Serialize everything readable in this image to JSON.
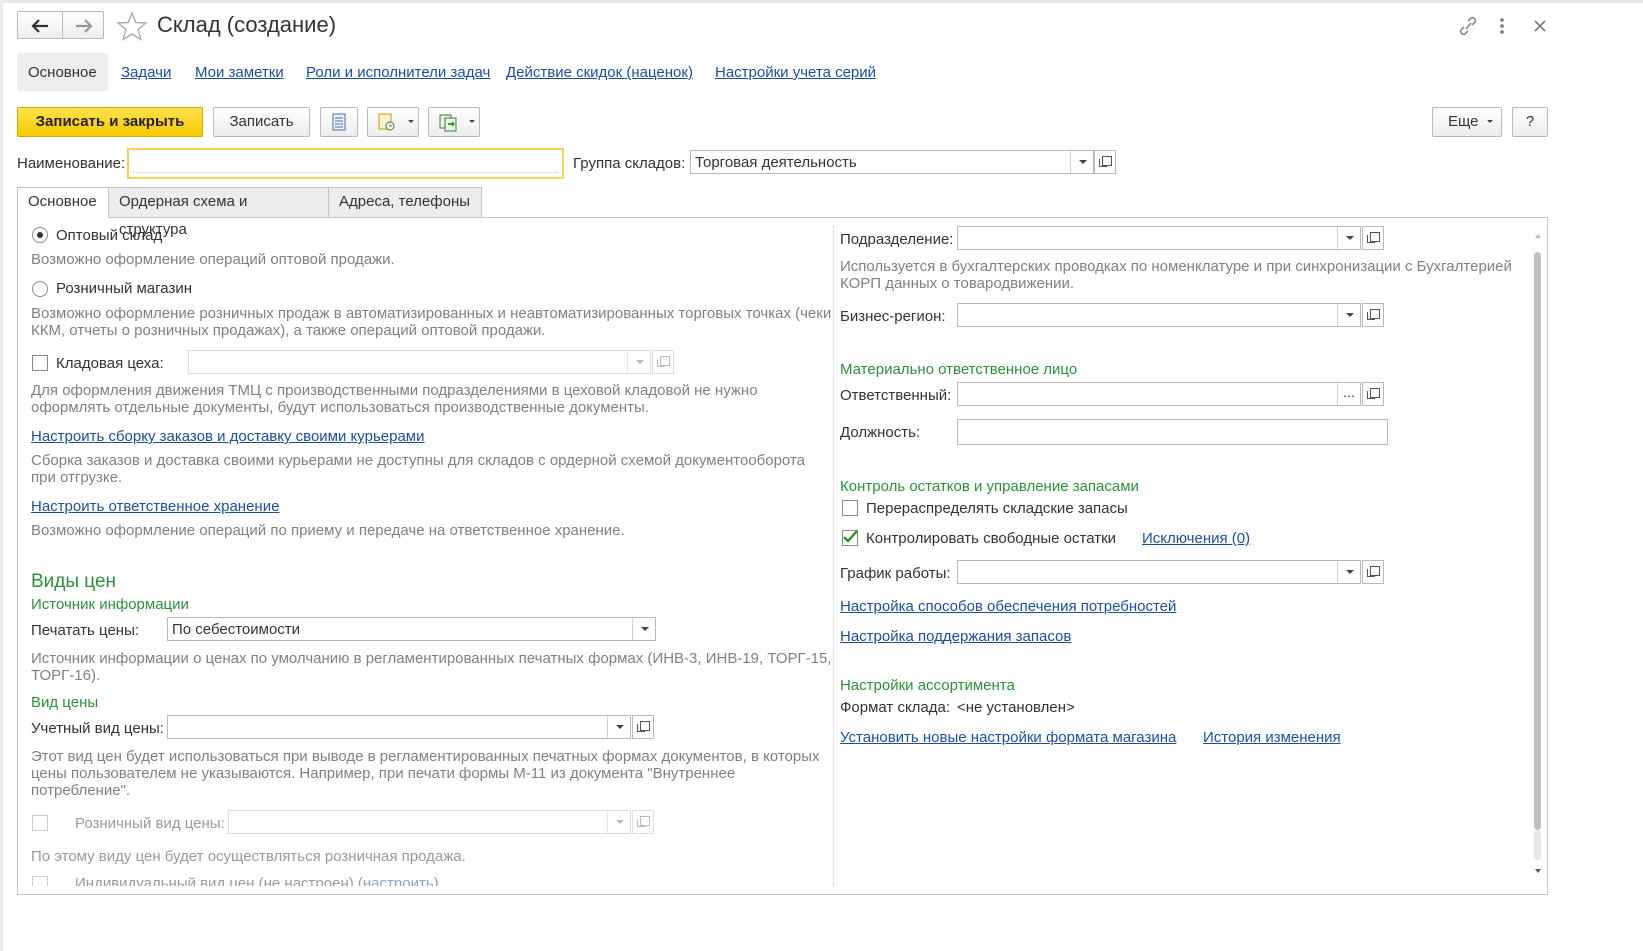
{
  "window": {
    "title": "Склад (создание)",
    "back_icon": "arrow-left-icon",
    "forward_icon": "arrow-right-icon",
    "favorite_icon": "star-icon",
    "link_icon": "link-icon",
    "more_icon": "vertical-dots-icon",
    "close_icon": "close-icon"
  },
  "nav_tabs": [
    "Основное",
    "Задачи",
    "Мои заметки",
    "Роли и исполнители задач",
    "Действие скидок (наценок)",
    "Настройки учета серий"
  ],
  "toolbar": {
    "save_close": "Записать и закрыть",
    "save": "Записать",
    "more": "Еще",
    "help": "?"
  },
  "header_fields": {
    "name_label": "Наименование:",
    "name_value": "",
    "group_label": "Группа складов:",
    "group_value": "Торговая деятельность"
  },
  "form_tabs": [
    "Основное",
    "Ордерная схема и структура",
    "Адреса, телефоны"
  ],
  "left": {
    "wholesale_label": "Оптовый склад",
    "wholesale_hint": "Возможно оформление операций оптовой продажи.",
    "retail_label": "Розничный магазин",
    "retail_hint_1": "Возможно оформление розничных продаж в автоматизированных и неавтоматизированных торговых точках (чеки",
    "retail_hint_2": "ККМ, отчеты о розничных продажах), а также операций оптовой продажи.",
    "workshop_label": "Кладовая цеха:",
    "workshop_hint_1": "Для оформления движения ТМЦ с производственными подразделениями в цеховой кладовой не нужно",
    "workshop_hint_2": "оформлять отдельные документы, будут использоваться производственные документы.",
    "courier_link": "Настроить сборку заказов и доставку своими курьерами",
    "courier_hint_1": "Сборка заказов и доставка своими курьерами не доступны для складов с ордерной схемой документооборота",
    "courier_hint_2": "при отгрузке.",
    "storage_link": "Настроить ответственное хранение",
    "storage_hint": "Возможно оформление операций по приему и передаче на ответственное хранение.",
    "price_types_title": "Виды цен",
    "source_title": "Источник информации",
    "print_prices_label": "Печатать цены:",
    "print_prices_value": "По себестоимости",
    "source_hint_1": "Источник информации о ценах по умолчанию в регламентированных печатных формах (ИНВ-3, ИНВ-19, ТОРГ-15,",
    "source_hint_2": "ТОРГ-16).",
    "price_type_title": "Вид цены",
    "account_price_label": "Учетный вид цены:",
    "account_price_hint_1": "Этот вид цен будет использоваться при выводе в регламентированных печатных формах документов, в которых",
    "account_price_hint_2": "цены пользователем не указываются. Например, при печати формы М-11 из документа \"Внутреннее",
    "account_price_hint_3": "потребление\".",
    "retail_price_label": "Розничный вид цены:",
    "retail_price_hint": "По этому виду цен будет осуществляться розничная продажа.",
    "individual_price_label": "Индивидуальный вид цен (не настроен) (",
    "individual_price_link": "настроить",
    "individual_price_end": ")"
  },
  "right": {
    "division_label": "Подразделение:",
    "division_hint_1": "Используется в бухгалтерских проводках по номенклатуре и при синхронизации с Бухгалтерией",
    "division_hint_2": "КОРП данных о товародвижении.",
    "region_label": "Бизнес-регион:",
    "responsible_title": "Материально ответственное лицо",
    "responsible_label": "Ответственный:",
    "position_label": "Должность:",
    "stock_title": "Контроль остатков и управление запасами",
    "redistribute_label": "Перераспределять складские запасы",
    "control_free_label": "Контролировать свободные остатки",
    "control_free_checked": true,
    "exceptions_link": "Исключения (0)",
    "schedule_label": "График работы:",
    "needs_link": "Настройка способов обеспечения потребностей",
    "reserve_link": "Настройка поддержания запасов",
    "assortment_title": "Настройки ассортимента",
    "format_label": "Формат склада:",
    "format_value": "<не установлен>",
    "format_link": "Установить новые настройки формата магазина",
    "history_link": "История изменения"
  },
  "colors": {
    "accent_yellow": "#f7c900",
    "link_blue": "#1c4e9a",
    "section_green": "#2d8f3c"
  }
}
